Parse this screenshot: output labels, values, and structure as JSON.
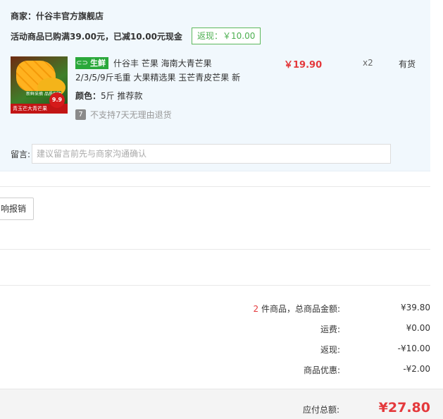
{
  "shop": {
    "label": "商家：",
    "name": "什谷丰官方旗舰店",
    "promo": "活动商品已购满39.00元，已减10.00元现金",
    "rebate_tag": "返现：￥10.00"
  },
  "item": {
    "fresh_tag": "生鲜",
    "title": "什谷丰 芒果 海南大青芒果 2/3/5/9斤毛重 大果精选果 玉芒青皮芒果 新",
    "spec_label": "颜色：",
    "spec_value": "5斤 推荐款",
    "no_return": "不支持7天无理由退货",
    "price": "￥19.90",
    "qty": "x2",
    "stock": "有货",
    "thumb": {
      "badge_top": "新鲜采摘 品质保障",
      "badge_bottom": "青玉芒大青芒果",
      "price_circle": "9.9"
    }
  },
  "message": {
    "label": "留言:",
    "placeholder": "建议留言前先与商家沟通确认"
  },
  "invoice": {
    "button_label": "响报销"
  },
  "summary": {
    "count": "2",
    "count_suffix": " 件商品，总商品金额:",
    "goods_total": "¥39.80",
    "shipping_label": "运费:",
    "shipping": "¥0.00",
    "rebate_label": "返现:",
    "rebate": "-¥10.00",
    "discount_label": "商品优惠:",
    "discount": "-¥2.00",
    "total_label": "应付总额:",
    "total": "¥27.80"
  },
  "colors": {
    "accent_red": "#e4393c",
    "fresh_green": "#2aa83a",
    "panel_bg": "#f1f8fd"
  }
}
